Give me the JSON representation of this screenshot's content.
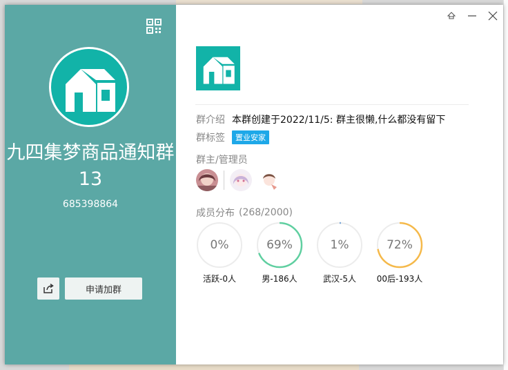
{
  "window": {
    "controls": [
      "pin-icon",
      "minimize-icon",
      "close-icon"
    ]
  },
  "left": {
    "group_name": "九四集梦商品通知群13",
    "group_id": "685398864",
    "join_label": "申请加群",
    "accent_color": "#5ba8a5"
  },
  "info": {
    "intro_label": "群介绍",
    "intro_value": "本群创建于2022/11/5:  群主很懒,什么都没有留下",
    "tags_label": "群标签",
    "tags": [
      "置业安家"
    ],
    "admins_label": "群主/管理员",
    "members_label": "成员分布",
    "members_count": "(268/2000)"
  },
  "stats": [
    {
      "value": "0%",
      "fraction": 0.0,
      "label": "活跃-0人",
      "color": "#e0e0e0"
    },
    {
      "value": "69%",
      "fraction": 0.69,
      "label": "男-186人",
      "color": "#5fcfa0"
    },
    {
      "value": "1%",
      "fraction": 0.01,
      "label": "武汉-5人",
      "color": "#7aa7d8"
    },
    {
      "value": "72%",
      "fraction": 0.72,
      "label": "00后-193人",
      "color": "#f5b94a"
    }
  ]
}
